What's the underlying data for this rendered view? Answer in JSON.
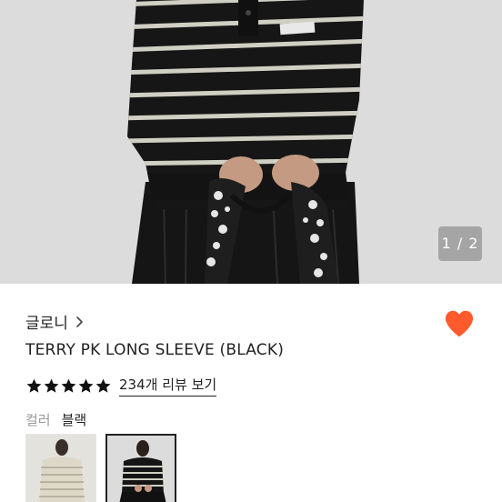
{
  "gallery": {
    "page_indicator": "1 / 2",
    "current_page": 1,
    "total_pages": 2
  },
  "product": {
    "brand": "글로니",
    "title": "TERRY PK LONG SLEEVE (BLACK)",
    "rating": 5,
    "review_link": "234개 리뷰 보기",
    "liked": true
  },
  "option": {
    "label": "컬러",
    "value": "블랙"
  },
  "variants": [
    {
      "color": "ivory",
      "selected": false
    },
    {
      "color": "black",
      "selected": true
    }
  ],
  "colors": {
    "accent": "#ff5a2c",
    "text": "#222222",
    "muted": "#9a9a9a"
  }
}
